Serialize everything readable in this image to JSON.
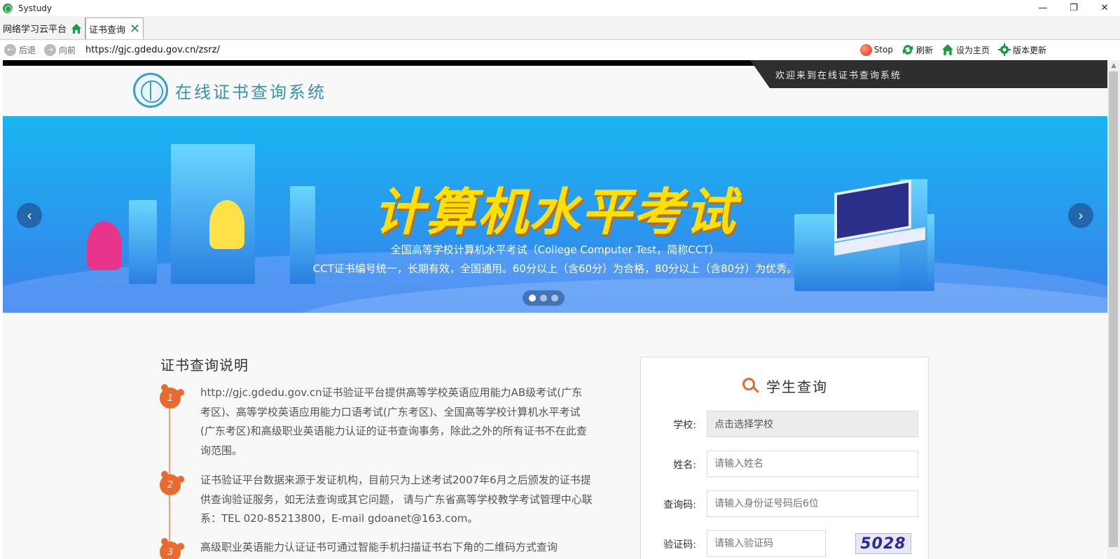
{
  "window": {
    "title": "5ystudy",
    "minimize": "—",
    "restore": "❐",
    "close": "✕"
  },
  "tabs": [
    {
      "label": "网络学习云平台"
    },
    {
      "label": "证书查询"
    }
  ],
  "nav": {
    "back_label": "后退",
    "forward_label": "向前",
    "url": "https://gjc.gdedu.gov.cn/zsrz/",
    "stop_label": "Stop",
    "refresh_label": "刷新",
    "homepage_label": "设为主页",
    "update_label": "版本更新"
  },
  "header": {
    "welcome": "欢迎来到在线证书查询系统",
    "site_title": "在线证书查询系统"
  },
  "banner": {
    "title": "计算机水平考试",
    "subtitle1": "全国高等学校计算机水平考试（College Computer Test，简称CCT）",
    "subtitle2": "CCT证书编号统一，长期有效，全国通用。60分以上（含60分）为合格，80分以上（含80分）为优秀。",
    "prev": "‹",
    "next": "›",
    "slide_count": 3,
    "active_slide": 1
  },
  "instructions": {
    "title": "证书查询说明",
    "items": [
      {
        "num": "1",
        "text": "http://gjc.gdedu.gov.cn证书验证平台提供高等学校英语应用能力AB级考试(广东考区)、高等学校英语应用能力口语考试(广东考区)、全国高等学校计算机水平考试(广东考区)和高级职业英语能力认证的证书查询事务，除此之外的所有证书不在此查询范围。"
      },
      {
        "num": "2",
        "text": "证书验证平台数据来源于发证机构，目前只为上述考试2007年6月之后颁发的证书提供查询验证服务，如无法查询或其它问题， 请与广东省高等学校教学考试管理中心联系：TEL 020-85213800，E-mail gdoanet@163.com。"
      },
      {
        "num": "3",
        "text": "高级职业英语能力认证证书可通过智能手机扫描证书右下角的二维码方式查询"
      }
    ]
  },
  "query": {
    "title": "学生查询",
    "school_label": "学校:",
    "school_value": "点击选择学校",
    "name_label": "姓名:",
    "name_placeholder": "请输入姓名",
    "code_label": "查询码:",
    "code_placeholder": "请输入身份证号码后6位",
    "captcha_label": "验证码:",
    "captcha_placeholder": "请输入验证码",
    "captcha_image_text": "5028"
  },
  "colors": {
    "accent": "#e86a2e",
    "banner_title": "#ffe000",
    "site_title": "#3a90b0"
  }
}
